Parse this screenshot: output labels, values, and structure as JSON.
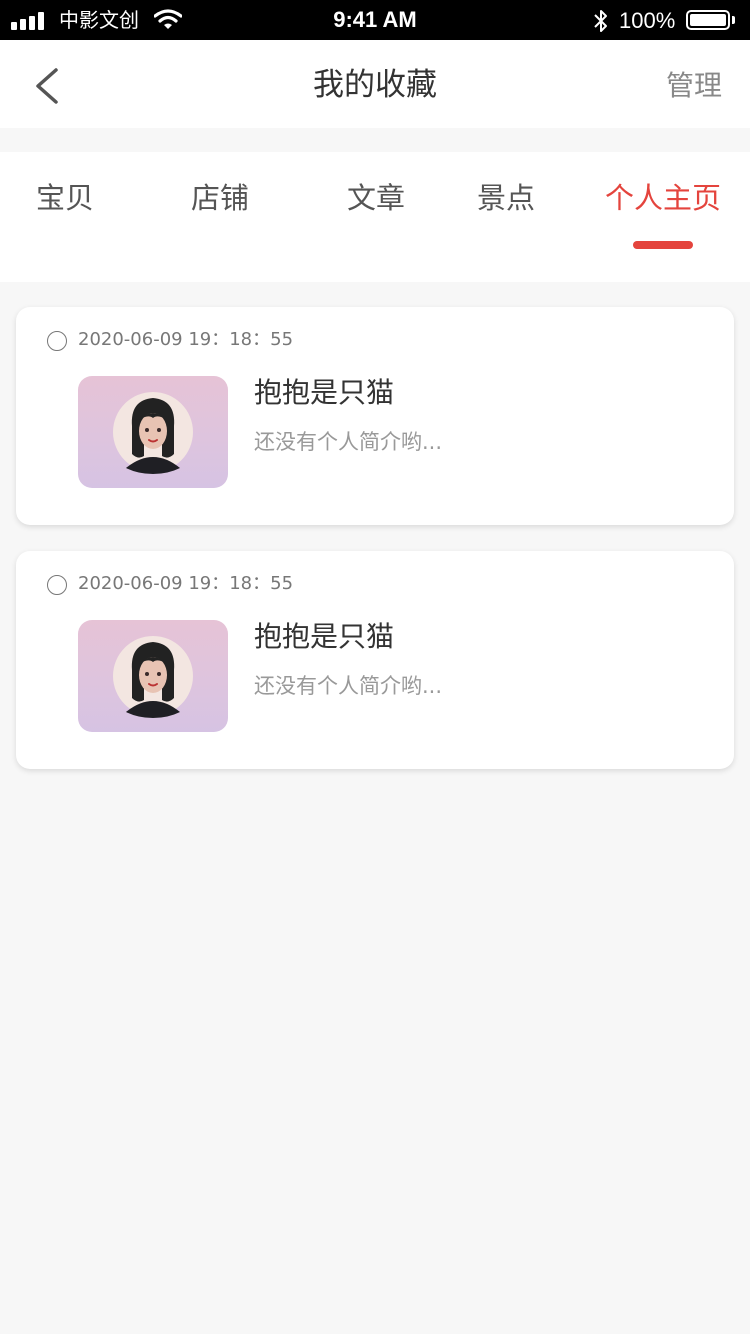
{
  "status_bar": {
    "carrier": "中影文创",
    "time": "9:41 AM",
    "battery": "100%"
  },
  "nav": {
    "title": "我的收藏",
    "manage_label": "管理",
    "back_icon": "chevron-left-icon"
  },
  "tabs": [
    {
      "label": "宝贝",
      "active": false
    },
    {
      "label": "店铺",
      "active": false
    },
    {
      "label": "文章",
      "active": false
    },
    {
      "label": "景点",
      "active": false
    },
    {
      "label": "个人主页",
      "active": true
    }
  ],
  "favorites": [
    {
      "timestamp": "2020-06-09 19：18：55",
      "name": "抱抱是只猫",
      "bio": "还没有个人简介哟..."
    },
    {
      "timestamp": "2020-06-09 19：18：55",
      "name": "抱抱是只猫",
      "bio": "还没有个人简介哟..."
    }
  ],
  "colors": {
    "accent": "#e4443d",
    "background": "#f7f7f7"
  }
}
